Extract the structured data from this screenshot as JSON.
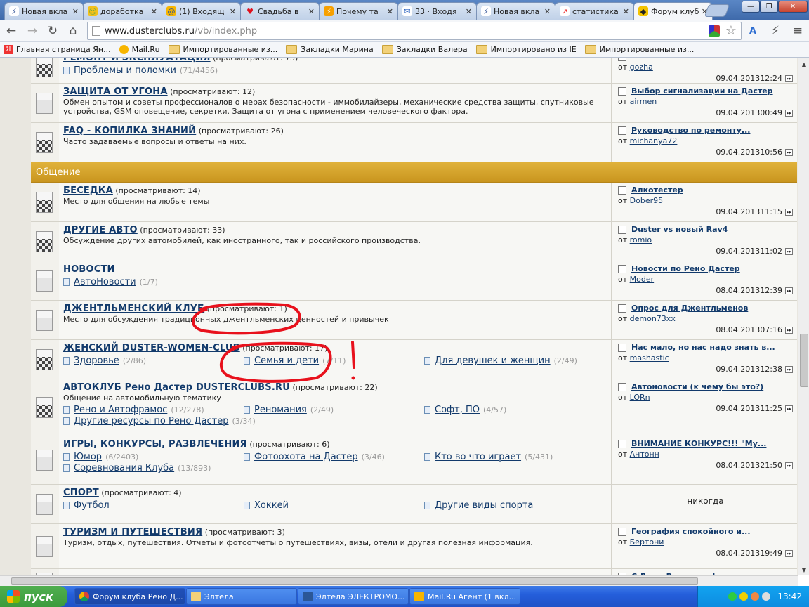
{
  "browser": {
    "tabs": [
      {
        "icon": "bolt",
        "label": "Новая вкла"
      },
      {
        "icon": "smiley",
        "label": "доработка"
      },
      {
        "icon": "mailru",
        "label": "(1) Входящ"
      },
      {
        "icon": "heart",
        "label": "Свадьба в"
      },
      {
        "icon": "bolt-orange",
        "label": "Почему та"
      },
      {
        "icon": "envelope",
        "label": "33 · Входя"
      },
      {
        "icon": "bolt",
        "label": "Новая вкла"
      },
      {
        "icon": "chart",
        "label": "статистика"
      },
      {
        "icon": "renault",
        "label": "Форум клуб"
      }
    ],
    "tab_close": "✕",
    "window_controls": {
      "minimize": "—",
      "maximize": "❐",
      "close": "✕"
    },
    "url_host": "www.dusterclubs.ru",
    "url_path": "/vb/index.php",
    "bookmarks": [
      {
        "icon": "yandex",
        "label": "Главная страница Ян..."
      },
      {
        "icon": "mailru",
        "label": "Mail.Ru"
      },
      {
        "icon": "folder",
        "label": "Импортированные из..."
      },
      {
        "icon": "folder",
        "label": "Закладки Марина"
      },
      {
        "icon": "folder",
        "label": "Закладки Валера"
      },
      {
        "icon": "folder",
        "label": "Импортировано из IE"
      },
      {
        "icon": "folder",
        "label": "Импортированные из..."
      }
    ]
  },
  "forum": {
    "rows": [
      {
        "title": "РЕМОНТ И ЭКСПЛУАТАЦИЯ",
        "viewing": "(просматривают: 73)",
        "desc": "",
        "icon": "checker",
        "subs": [
          {
            "label": "Проблемы и поломки",
            "count": "(71/4456)"
          }
        ],
        "last": {
          "title": "",
          "by": "от",
          "user": "gozha",
          "date": "09.04.2013",
          "time": "12:24"
        }
      },
      {
        "title": "ЗАЩИТА ОТ УГОНА",
        "viewing": "(просматривают: 12)",
        "desc": "Обмен опытом и советы профессионалов о мерах безопасности - иммобилайзеры, механические средства защиты, спутниковые устройства, GSM оповещение, секретки. Защита от угона с применением человеческого фактора.",
        "icon": "plain",
        "subs": [],
        "last": {
          "title": "Выбор сигнализации на Дастер",
          "by": "от",
          "user": "airmen",
          "date": "09.04.2013",
          "time": "00:49"
        }
      },
      {
        "title": "FAQ - КОПИЛКА ЗНАНИЙ",
        "viewing": "(просматривают: 26)",
        "desc": "Часто задаваемые вопросы и ответы на них.",
        "icon": "checker",
        "subs": [],
        "last": {
          "title": "Руководство по ремонту...",
          "by": "от",
          "user": "michanya72",
          "date": "09.04.2013",
          "time": "10:56"
        }
      }
    ],
    "category": "Общение",
    "rows2": [
      {
        "title": "БЕСЕДКА",
        "viewing": "(просматривают: 14)",
        "desc": "Место для общения на любые темы",
        "icon": "checker",
        "subs": [],
        "last": {
          "title": "Алкотестер",
          "by": "от",
          "user": "Dober95",
          "date": "09.04.2013",
          "time": "11:15"
        }
      },
      {
        "title": "ДРУГИЕ АВТО",
        "viewing": "(просматривают: 33)",
        "desc": "Обсуждение других автомобилей, как иностранного, так и российского производства.",
        "icon": "checker",
        "subs": [],
        "last": {
          "title": "Duster vs новый Rav4",
          "by": "от",
          "user": "romio",
          "date": "09.04.2013",
          "time": "11:02"
        }
      },
      {
        "title": "НОВОСТИ",
        "viewing": "",
        "desc": "",
        "icon": "plain",
        "subs": [
          {
            "label": "АвтоНовости",
            "count": "(1/7)"
          }
        ],
        "last": {
          "title": "Новости по Рено Дастер",
          "by": "от",
          "user": "Moder",
          "date": "08.04.2013",
          "time": "12:39"
        }
      },
      {
        "title": "ДЖЕНТЛЬМЕНСКИЙ КЛУБ",
        "viewing": "(просматривают: 1)",
        "desc": "Место для обсуждения традиционных джентльменских ценностей и привычек",
        "icon": "plain",
        "subs": [],
        "last": {
          "title": "Опрос для Джентльменов",
          "by": "от",
          "user": "demon73xx",
          "date": "08.04.2013",
          "time": "07:16"
        }
      },
      {
        "title": "ЖЕНСКИЙ DUSTER-WOMEN-CLUB",
        "viewing": "(просматривают: 17)",
        "desc": "",
        "icon": "checker",
        "subs": [
          {
            "label": "Здоровье",
            "count": "(2/86)"
          },
          {
            "label": "Семья и дети",
            "count": "(7/11)"
          },
          {
            "label": "Для девушек и женщин",
            "count": "(2/49)"
          }
        ],
        "last": {
          "title": "Нас мало, но нас надо знать в...",
          "by": "от",
          "user": "mashastic",
          "date": "09.04.2013",
          "time": "12:38"
        }
      },
      {
        "title": "АВТОКЛУБ Рено Дастер DUSTERCLUBS.RU",
        "viewing": "(просматривают: 22)",
        "desc": "Общение на автомобильную тематику",
        "icon": "checker",
        "subs": [
          {
            "label": "Рено и Автофрамос",
            "count": "(12/278)"
          },
          {
            "label": "Реномания",
            "count": "(2/49)"
          },
          {
            "label": "Софт, ПО",
            "count": "(4/57)"
          },
          {
            "label": "Другие ресурсы по Рено Дастер",
            "count": "(3/34)"
          }
        ],
        "last": {
          "title": "Автоновости (к чему бы это?)",
          "by": "от",
          "user": "LORn",
          "date": "09.04.2013",
          "time": "11:25"
        }
      },
      {
        "title": "ИГРЫ, КОНКУРСЫ, РАЗВЛЕЧЕНИЯ",
        "viewing": "(просматривают: 6)",
        "desc": "",
        "icon": "plain",
        "subs": [
          {
            "label": "Юмор",
            "count": "(6/2403)"
          },
          {
            "label": "Фотоохота на Дастер",
            "count": "(3/46)"
          },
          {
            "label": "Кто во что играет",
            "count": "(5/431)"
          },
          {
            "label": "Соревнования Клуба",
            "count": "(13/893)"
          }
        ],
        "last": {
          "title": "ВНИМАНИЕ КОНКУРС!!! \"Му...",
          "by": "от",
          "user": "Антонн",
          "date": "08.04.2013",
          "time": "21:50"
        }
      },
      {
        "title": "СПОРТ",
        "viewing": "(просматривают: 4)",
        "desc": "",
        "icon": "plain",
        "subs": [
          {
            "label": "Футбол",
            "count": ""
          },
          {
            "label": "Хоккей",
            "count": ""
          },
          {
            "label": "Другие виды спорта",
            "count": ""
          }
        ],
        "last": {
          "never": "никогда"
        }
      },
      {
        "title": "ТУРИЗМ И ПУТЕШЕСТВИЯ",
        "viewing": "(просматривают: 3)",
        "desc": "Туризм, отдых, путешествия. Отчеты и фотоотчеты о путешествиях, визы, отели и другая полезная информация.",
        "icon": "plain",
        "subs": [],
        "last": {
          "title": "География спокойного и...",
          "by": "от",
          "user": "Бертони",
          "date": "08.04.2013",
          "time": "19:49"
        }
      },
      {
        "title": "",
        "viewing": "",
        "desc": "",
        "icon": "plain",
        "subs": [],
        "last": {
          "title": "С Днем Рождения!",
          "by": "",
          "user": "",
          "date": "",
          "time": ""
        }
      }
    ]
  },
  "taskbar": {
    "start_label": "пуск",
    "items": [
      {
        "icon": "chrome",
        "label": "Форум клуба Рено Д..."
      },
      {
        "icon": "folder",
        "label": "Элтела"
      },
      {
        "icon": "word",
        "label": "Элтела ЭЛЕКТРОМО..."
      },
      {
        "icon": "mail-agent",
        "label": "Mail.Ru Агент (1 вкл..."
      }
    ],
    "clock": "13:42"
  },
  "annotations": {
    "exclamation": "!",
    "color": "#e8111c"
  }
}
